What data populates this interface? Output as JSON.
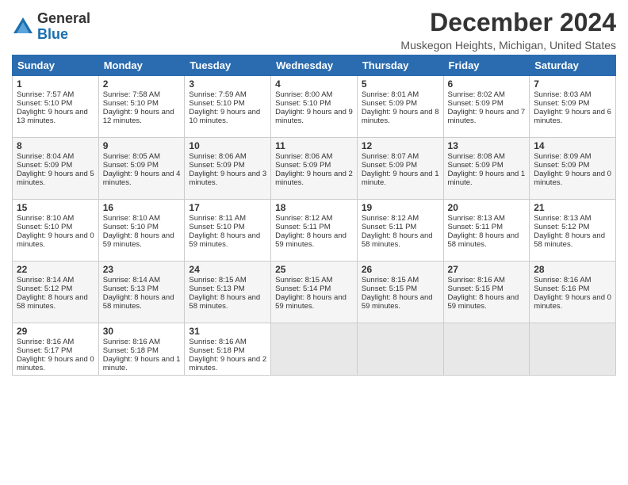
{
  "header": {
    "logo_general": "General",
    "logo_blue": "Blue",
    "month_title": "December 2024",
    "location": "Muskegon Heights, Michigan, United States"
  },
  "days_of_week": [
    "Sunday",
    "Monday",
    "Tuesday",
    "Wednesday",
    "Thursday",
    "Friday",
    "Saturday"
  ],
  "weeks": [
    [
      {
        "day": "1",
        "sunrise": "7:57 AM",
        "sunset": "5:10 PM",
        "daylight": "9 hours and 13 minutes."
      },
      {
        "day": "2",
        "sunrise": "7:58 AM",
        "sunset": "5:10 PM",
        "daylight": "9 hours and 12 minutes."
      },
      {
        "day": "3",
        "sunrise": "7:59 AM",
        "sunset": "5:10 PM",
        "daylight": "9 hours and 10 minutes."
      },
      {
        "day": "4",
        "sunrise": "8:00 AM",
        "sunset": "5:10 PM",
        "daylight": "9 hours and 9 minutes."
      },
      {
        "day": "5",
        "sunrise": "8:01 AM",
        "sunset": "5:09 PM",
        "daylight": "9 hours and 8 minutes."
      },
      {
        "day": "6",
        "sunrise": "8:02 AM",
        "sunset": "5:09 PM",
        "daylight": "9 hours and 7 minutes."
      },
      {
        "day": "7",
        "sunrise": "8:03 AM",
        "sunset": "5:09 PM",
        "daylight": "9 hours and 6 minutes."
      }
    ],
    [
      {
        "day": "8",
        "sunrise": "8:04 AM",
        "sunset": "5:09 PM",
        "daylight": "9 hours and 5 minutes."
      },
      {
        "day": "9",
        "sunrise": "8:05 AM",
        "sunset": "5:09 PM",
        "daylight": "9 hours and 4 minutes."
      },
      {
        "day": "10",
        "sunrise": "8:06 AM",
        "sunset": "5:09 PM",
        "daylight": "9 hours and 3 minutes."
      },
      {
        "day": "11",
        "sunrise": "8:06 AM",
        "sunset": "5:09 PM",
        "daylight": "9 hours and 2 minutes."
      },
      {
        "day": "12",
        "sunrise": "8:07 AM",
        "sunset": "5:09 PM",
        "daylight": "9 hours and 1 minute."
      },
      {
        "day": "13",
        "sunrise": "8:08 AM",
        "sunset": "5:09 PM",
        "daylight": "9 hours and 1 minute."
      },
      {
        "day": "14",
        "sunrise": "8:09 AM",
        "sunset": "5:09 PM",
        "daylight": "9 hours and 0 minutes."
      }
    ],
    [
      {
        "day": "15",
        "sunrise": "8:10 AM",
        "sunset": "5:10 PM",
        "daylight": "9 hours and 0 minutes."
      },
      {
        "day": "16",
        "sunrise": "8:10 AM",
        "sunset": "5:10 PM",
        "daylight": "8 hours and 59 minutes."
      },
      {
        "day": "17",
        "sunrise": "8:11 AM",
        "sunset": "5:10 PM",
        "daylight": "8 hours and 59 minutes."
      },
      {
        "day": "18",
        "sunrise": "8:12 AM",
        "sunset": "5:11 PM",
        "daylight": "8 hours and 59 minutes."
      },
      {
        "day": "19",
        "sunrise": "8:12 AM",
        "sunset": "5:11 PM",
        "daylight": "8 hours and 58 minutes."
      },
      {
        "day": "20",
        "sunrise": "8:13 AM",
        "sunset": "5:11 PM",
        "daylight": "8 hours and 58 minutes."
      },
      {
        "day": "21",
        "sunrise": "8:13 AM",
        "sunset": "5:12 PM",
        "daylight": "8 hours and 58 minutes."
      }
    ],
    [
      {
        "day": "22",
        "sunrise": "8:14 AM",
        "sunset": "5:12 PM",
        "daylight": "8 hours and 58 minutes."
      },
      {
        "day": "23",
        "sunrise": "8:14 AM",
        "sunset": "5:13 PM",
        "daylight": "8 hours and 58 minutes."
      },
      {
        "day": "24",
        "sunrise": "8:15 AM",
        "sunset": "5:13 PM",
        "daylight": "8 hours and 58 minutes."
      },
      {
        "day": "25",
        "sunrise": "8:15 AM",
        "sunset": "5:14 PM",
        "daylight": "8 hours and 59 minutes."
      },
      {
        "day": "26",
        "sunrise": "8:15 AM",
        "sunset": "5:15 PM",
        "daylight": "8 hours and 59 minutes."
      },
      {
        "day": "27",
        "sunrise": "8:16 AM",
        "sunset": "5:15 PM",
        "daylight": "8 hours and 59 minutes."
      },
      {
        "day": "28",
        "sunrise": "8:16 AM",
        "sunset": "5:16 PM",
        "daylight": "9 hours and 0 minutes."
      }
    ],
    [
      {
        "day": "29",
        "sunrise": "8:16 AM",
        "sunset": "5:17 PM",
        "daylight": "9 hours and 0 minutes."
      },
      {
        "day": "30",
        "sunrise": "8:16 AM",
        "sunset": "5:18 PM",
        "daylight": "9 hours and 1 minute."
      },
      {
        "day": "31",
        "sunrise": "8:16 AM",
        "sunset": "5:18 PM",
        "daylight": "9 hours and 2 minutes."
      },
      null,
      null,
      null,
      null
    ]
  ],
  "labels": {
    "sunrise": "Sunrise:",
    "sunset": "Sunset:",
    "daylight": "Daylight:"
  }
}
